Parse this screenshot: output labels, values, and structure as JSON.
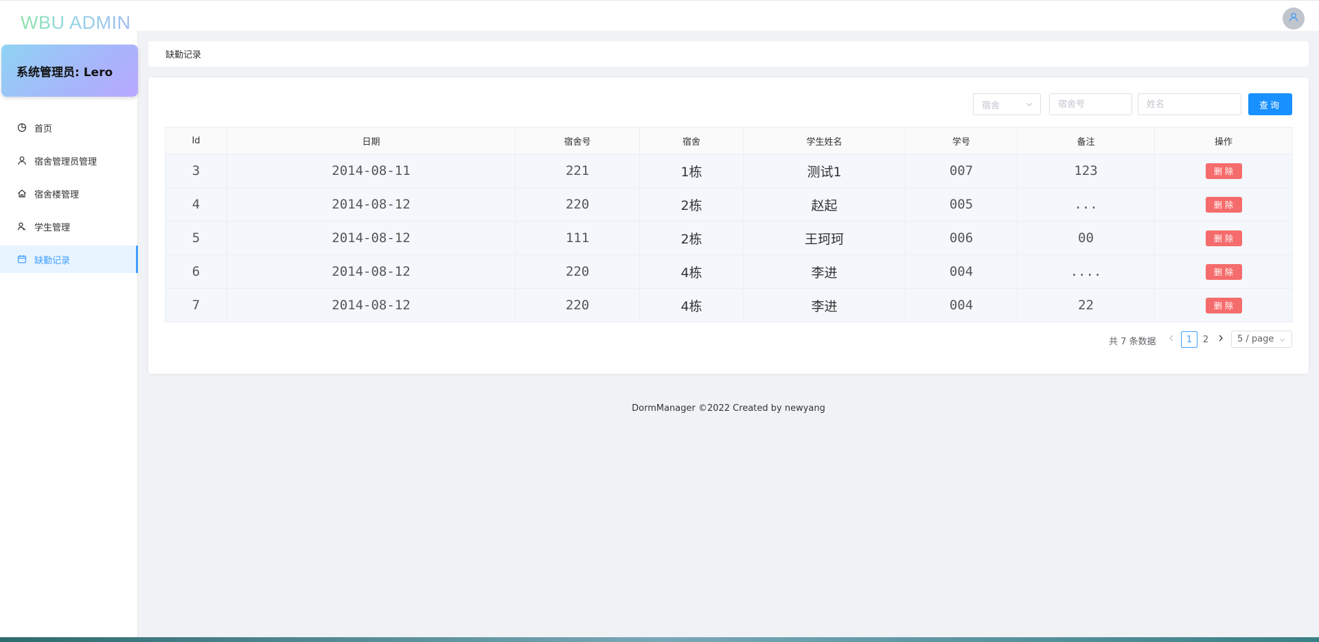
{
  "app": {
    "logo": "WBU ADMIN"
  },
  "user": {
    "label": "系统管理员: Lero"
  },
  "sidebar": {
    "items": [
      {
        "label": "首页",
        "icon": "pie-chart-icon",
        "active": false
      },
      {
        "label": "宿舍管理员管理",
        "icon": "user-icon",
        "active": false
      },
      {
        "label": "宿舍楼管理",
        "icon": "home-icon",
        "active": false
      },
      {
        "label": "学生管理",
        "icon": "users-icon",
        "active": false
      },
      {
        "label": "缺勤记录",
        "icon": "calendar-icon",
        "active": true
      }
    ]
  },
  "breadcrumb": {
    "current": "缺勤记录"
  },
  "filters": {
    "dorm_select_placeholder": "宿舍",
    "room_placeholder": "宿舍号",
    "name_placeholder": "姓名",
    "query_label": "查询"
  },
  "table": {
    "headers": [
      "Id",
      "日期",
      "宿舍号",
      "宿舍",
      "学生姓名",
      "学号",
      "备注",
      "操作"
    ],
    "rows": [
      {
        "id": "3",
        "date": "2014-08-11",
        "room": "221",
        "dorm": "1栋",
        "name": "测试1",
        "student_no": "007",
        "remark": "123",
        "action": "删除"
      },
      {
        "id": "4",
        "date": "2014-08-12",
        "room": "220",
        "dorm": "2栋",
        "name": "赵起",
        "student_no": "005",
        "remark": "...",
        "action": "删除"
      },
      {
        "id": "5",
        "date": "2014-08-12",
        "room": "111",
        "dorm": "2栋",
        "name": "王珂珂",
        "student_no": "006",
        "remark": "00",
        "action": "删除"
      },
      {
        "id": "6",
        "date": "2014-08-12",
        "room": "220",
        "dorm": "4栋",
        "name": "李进",
        "student_no": "004",
        "remark": "....",
        "action": "删除"
      },
      {
        "id": "7",
        "date": "2014-08-12",
        "room": "220",
        "dorm": "4栋",
        "name": "李进",
        "student_no": "004",
        "remark": "22",
        "action": "删除"
      }
    ]
  },
  "pagination": {
    "total_text": "共 7 条数据",
    "pages": [
      "1",
      "2"
    ],
    "current_page": "1",
    "page_size": "5 / page"
  },
  "footer": {
    "text": "DormManager ©2022 Created by newyang"
  },
  "colors": {
    "primary": "#1890ff",
    "danger": "#f56c6c",
    "active_menu_bg": "#e8f4ff",
    "accent": "#409eff"
  }
}
